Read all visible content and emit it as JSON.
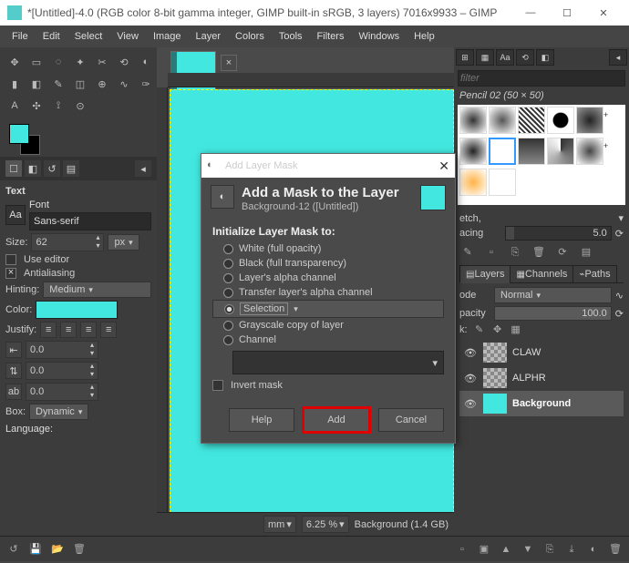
{
  "window": {
    "title": "*[Untitled]-4.0 (RGB color 8-bit gamma integer, GIMP built-in sRGB, 3 layers) 7016x9933 – GIMP"
  },
  "menu": {
    "file": "File",
    "edit": "Edit",
    "select": "Select",
    "view": "View",
    "image": "Image",
    "layer": "Layer",
    "colors": "Colors",
    "tools": "Tools",
    "filters": "Filters",
    "windows": "Windows",
    "help": "Help"
  },
  "text_panel": {
    "title": "Text",
    "font_label": "Font",
    "font_value": "Sans-serif",
    "size_label": "Size:",
    "size_value": "62",
    "size_unit": "px",
    "use_editor": "Use editor",
    "antialias": "Antialiasing",
    "hinting_label": "Hinting:",
    "hinting_value": "Medium",
    "color_label": "Color:",
    "color_value": "#42e8e0",
    "justify_label": "Justify:",
    "indent1": "0.0",
    "indent2": "0.0",
    "indent3": "0.0",
    "box_label": "Box:",
    "box_value": "Dynamic",
    "lang_label": "Language:"
  },
  "brushes": {
    "filter_placeholder": "filter",
    "name": "Pencil 02 (50 × 50)"
  },
  "brush_ctrls": {
    "etch": "etch,",
    "acing": "acing",
    "acing_val": "5.0"
  },
  "layer_panel": {
    "layers_tab": "Layers",
    "channels_tab": "Channels",
    "paths_tab": "Paths",
    "mode_label": "ode",
    "mode_value": "Normal",
    "opacity_label": "pacity",
    "opacity_value": "100.0",
    "lock_label": "k:",
    "layers": [
      {
        "name": "CLAW"
      },
      {
        "name": "ALPHR"
      },
      {
        "name": "Background"
      }
    ]
  },
  "status": {
    "unit": "mm",
    "zoom": "6.25 %",
    "info": "Background (1.4 GB)"
  },
  "dialog": {
    "title": "Add Layer Mask",
    "heading": "Add a Mask to the Layer",
    "sub": "Background-12 ([Untitled])",
    "init_label": "Initialize Layer Mask to:",
    "opts": {
      "white": "White (full opacity)",
      "black": "Black (full transparency)",
      "alpha": "Layer's alpha channel",
      "transfer": "Transfer layer's alpha channel",
      "selection": "Selection",
      "grayscale": "Grayscale copy of layer",
      "channel": "Channel"
    },
    "invert": "Invert mask",
    "help": "Help",
    "add": "Add",
    "cancel": "Cancel"
  }
}
